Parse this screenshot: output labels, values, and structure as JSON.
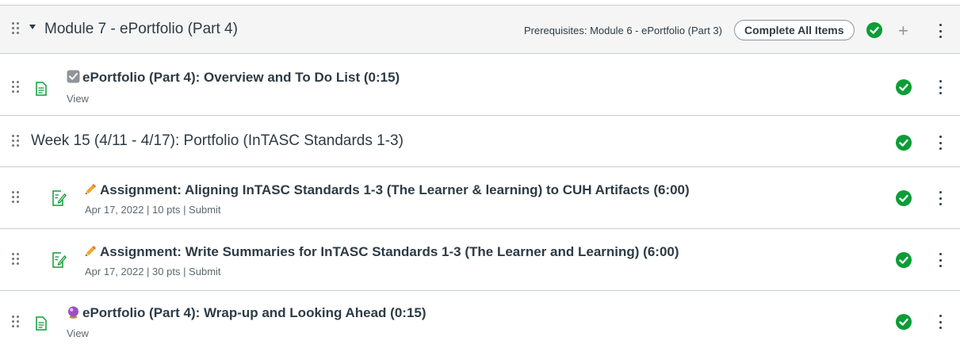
{
  "module": {
    "title": "Module 7 - ePortfolio (Part 4)",
    "prerequisites": "Prerequisites: Module 6 - ePortfolio (Part 3)",
    "requirement": "Complete All Items",
    "completed": true
  },
  "items": [
    {
      "type": "page",
      "prefix_icon": "checkbox-icon",
      "title": "ePortfolio (Part 4): Overview and To Do List (0:15)",
      "meta": "View",
      "completed": true
    },
    {
      "type": "subheader",
      "title": "Week 15 (4/11 - 4/17): Portfolio (InTASC Standards 1-3)",
      "completed": true
    },
    {
      "type": "assignment",
      "prefix_icon": "pencil-icon",
      "title": "Assignment: Aligning InTASC Standards 1-3 (The Learner & learning) to CUH Artifacts (6:00)",
      "meta": "Apr 17, 2022  |  10 pts  |  Submit",
      "completed": true
    },
    {
      "type": "assignment",
      "prefix_icon": "pencil-icon",
      "title": "Assignment: Write Summaries for InTASC Standards 1-3 (The Learner and Learning) (6:00)",
      "meta": "Apr 17, 2022  |  30 pts  |  Submit",
      "completed": true
    },
    {
      "type": "page",
      "prefix_icon": "crystal-ball-icon",
      "title": "ePortfolio (Part 4): Wrap-up and Looking Ahead (0:15)",
      "meta": "View",
      "completed": true
    }
  ],
  "colors": {
    "success": "#0b9d36",
    "text": "#2d3b45",
    "header_bg": "#f5f5f5",
    "border": "#c7cdd1"
  }
}
